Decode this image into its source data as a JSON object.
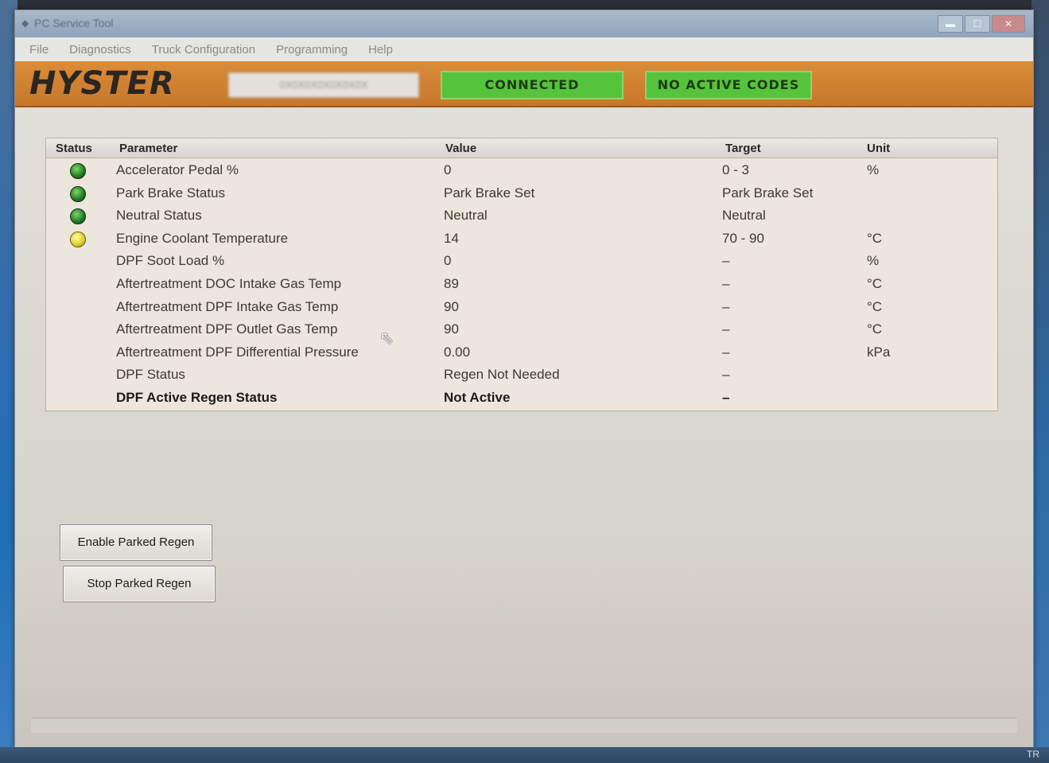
{
  "window": {
    "title": "PC Service Tool"
  },
  "menu": [
    "File",
    "Diagnostics",
    "Truck Configuration",
    "Programming",
    "Help"
  ],
  "header": {
    "logo": "HYSTER",
    "serial": "0X0X0X0X0X0X0X",
    "connection_status": "CONNECTED",
    "codes_status": "NO ACTIVE CODES",
    "status_color": "#56c33c",
    "brand_color": "#d98d3a"
  },
  "table": {
    "columns": [
      "Status",
      "Parameter",
      "Value",
      "Target",
      "Unit"
    ],
    "rows": [
      {
        "status": "green",
        "parameter": "Accelerator Pedal %",
        "value": "0",
        "target": "0 - 3",
        "unit": "%"
      },
      {
        "status": "green",
        "parameter": "Park Brake Status",
        "value": "Park Brake Set",
        "target": "Park Brake Set",
        "unit": ""
      },
      {
        "status": "green",
        "parameter": "Neutral Status",
        "value": "Neutral",
        "target": "Neutral",
        "unit": ""
      },
      {
        "status": "yellow",
        "parameter": "Engine Coolant Temperature",
        "value": "14",
        "target": "70 - 90",
        "unit": "°C"
      },
      {
        "status": "none",
        "parameter": "DPF Soot Load %",
        "value": "0",
        "target": "–",
        "unit": "%"
      },
      {
        "status": "none",
        "parameter": "Aftertreatment DOC Intake Gas Temp",
        "value": "89",
        "target": "–",
        "unit": "°C"
      },
      {
        "status": "none",
        "parameter": "Aftertreatment DPF Intake Gas Temp",
        "value": "90",
        "target": "–",
        "unit": "°C"
      },
      {
        "status": "none",
        "parameter": "Aftertreatment DPF Outlet Gas Temp",
        "value": "90",
        "target": "–",
        "unit": "°C"
      },
      {
        "status": "none",
        "parameter": "Aftertreatment DPF Differential Pressure",
        "value": "0.00",
        "target": "–",
        "unit": "kPa"
      },
      {
        "status": "none",
        "parameter": "DPF Status",
        "value": "Regen Not Needed",
        "target": "–",
        "unit": ""
      },
      {
        "status": "none",
        "parameter": "DPF Active Regen Status",
        "value": "Not Active",
        "target": "–",
        "unit": "",
        "bold": true
      }
    ]
  },
  "buttons": {
    "enable": "Enable Parked Regen",
    "stop": "Stop Parked Regen"
  },
  "tray": {
    "lang": "TR"
  }
}
